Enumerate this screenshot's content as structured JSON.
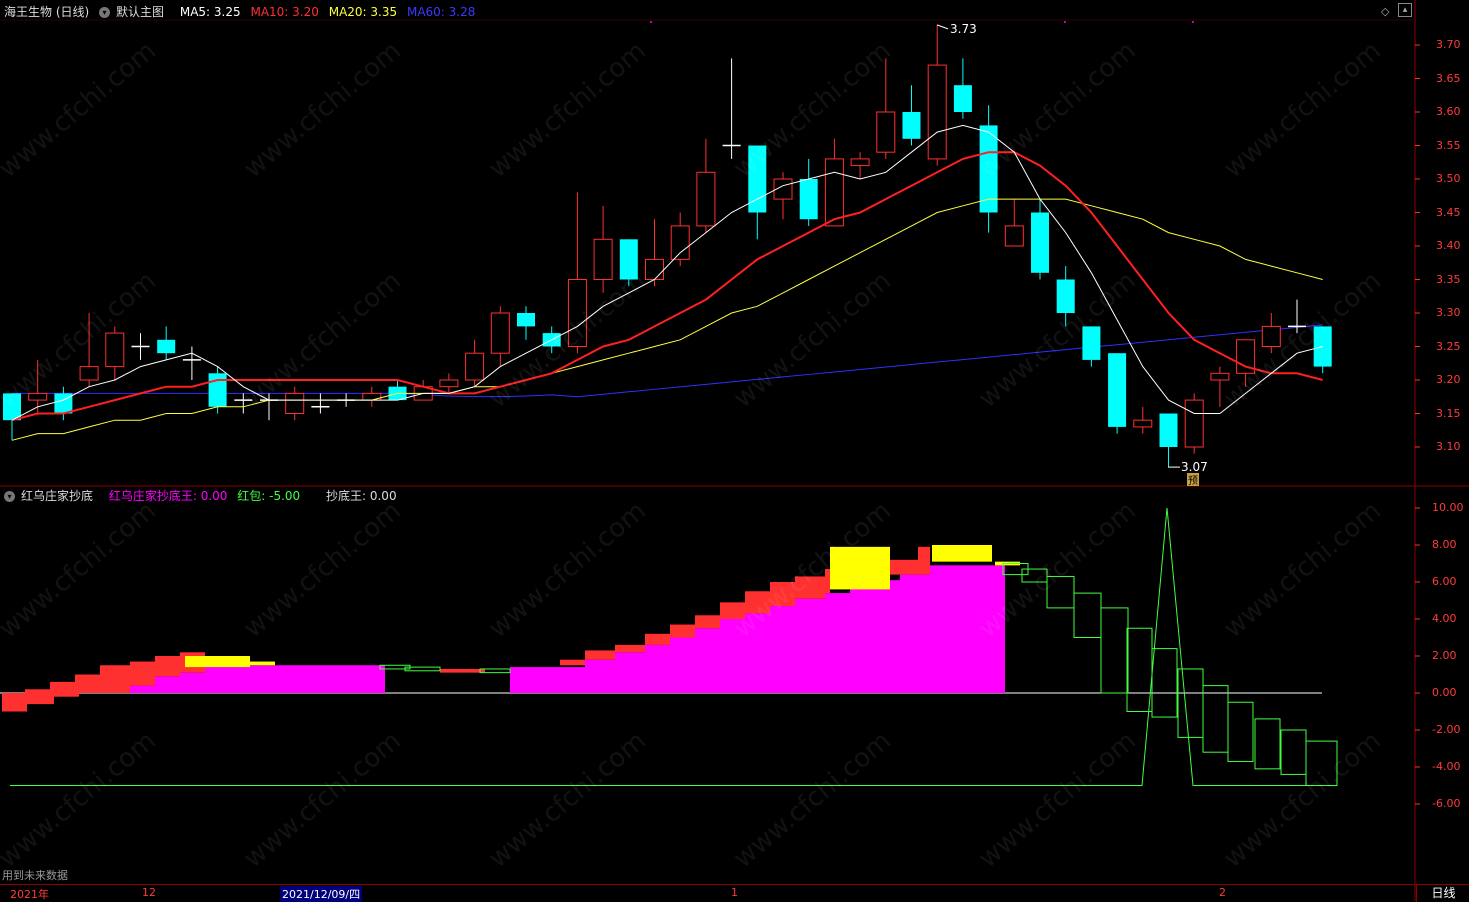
{
  "header_main": {
    "stock": "海王生物 (日线)",
    "indicator": "默认主图",
    "ma5": "MA5: 3.25",
    "ma10": "MA10: 3.20",
    "ma20": "MA20: 3.35",
    "ma60": "MA60: 3.28"
  },
  "header_sub": {
    "indicator": "红乌庄家抄底",
    "v1": "红乌庄家抄底王: 0.00",
    "v2": "红包: -5.00",
    "v3": "抄底王: 0.00"
  },
  "price_axis": [
    "3.70",
    "3.65",
    "3.60",
    "3.55",
    "3.50",
    "3.45",
    "3.40",
    "3.35",
    "3.30",
    "3.25",
    "3.20",
    "3.15",
    "3.10"
  ],
  "sub_axis": [
    "10.00",
    "8.00",
    "6.00",
    "4.00",
    "2.00",
    "0.00",
    "-2.00",
    "-4.00",
    "-6.00"
  ],
  "annotations": {
    "high": "3.73",
    "low": "3.07",
    "marker": "预"
  },
  "date_bar": {
    "year": "2021年",
    "m12": "12",
    "active": "2021/12/09/四",
    "m1": "1",
    "m2": "2"
  },
  "period": "日线",
  "future_note": "用到未来数据",
  "watermark": "www.cfchi.com",
  "colors": {
    "up": "#ff3030",
    "down": "#00ffff",
    "ma5": "#ffffff",
    "ma10": "#ff2020",
    "ma20": "#ffff40",
    "ma60": "#3030ff",
    "magenta": "#ff00ff",
    "yellow": "#ffff00",
    "green": "#40ff40"
  },
  "candles": [
    [
      3.18,
      3.14,
      3.11,
      3.18
    ],
    [
      3.17,
      3.18,
      3.15,
      3.23
    ],
    [
      3.18,
      3.15,
      3.14,
      3.19
    ],
    [
      3.2,
      3.22,
      3.19,
      3.3
    ],
    [
      3.22,
      3.27,
      3.2,
      3.28
    ],
    [
      3.25,
      3.25,
      3.23,
      3.27
    ],
    [
      3.26,
      3.24,
      3.23,
      3.28
    ],
    [
      3.23,
      3.23,
      3.2,
      3.25
    ],
    [
      3.21,
      3.16,
      3.15,
      3.22
    ],
    [
      3.17,
      3.17,
      3.15,
      3.18
    ],
    [
      3.17,
      3.17,
      3.14,
      3.18
    ],
    [
      3.15,
      3.18,
      3.14,
      3.19
    ],
    [
      3.16,
      3.16,
      3.15,
      3.18
    ],
    [
      3.17,
      3.17,
      3.16,
      3.18
    ],
    [
      3.17,
      3.18,
      3.16,
      3.19
    ],
    [
      3.19,
      3.17,
      3.17,
      3.2
    ],
    [
      3.17,
      3.19,
      3.17,
      3.2
    ],
    [
      3.19,
      3.2,
      3.18,
      3.21
    ],
    [
      3.2,
      3.24,
      3.19,
      3.26
    ],
    [
      3.24,
      3.3,
      3.22,
      3.31
    ],
    [
      3.3,
      3.28,
      3.26,
      3.31
    ],
    [
      3.27,
      3.25,
      3.24,
      3.28
    ],
    [
      3.25,
      3.35,
      3.24,
      3.48
    ],
    [
      3.35,
      3.41,
      3.33,
      3.46
    ],
    [
      3.41,
      3.35,
      3.34,
      3.41
    ],
    [
      3.35,
      3.38,
      3.34,
      3.44
    ],
    [
      3.38,
      3.43,
      3.37,
      3.45
    ],
    [
      3.43,
      3.51,
      3.42,
      3.56
    ],
    [
      3.55,
      3.55,
      3.53,
      3.68
    ],
    [
      3.55,
      3.45,
      3.41,
      3.55
    ],
    [
      3.47,
      3.5,
      3.44,
      3.51
    ],
    [
      3.5,
      3.44,
      3.43,
      3.53
    ],
    [
      3.43,
      3.53,
      3.43,
      3.56
    ],
    [
      3.52,
      3.53,
      3.5,
      3.54
    ],
    [
      3.54,
      3.6,
      3.53,
      3.68
    ],
    [
      3.6,
      3.56,
      3.55,
      3.64
    ],
    [
      3.53,
      3.67,
      3.52,
      3.73
    ],
    [
      3.64,
      3.6,
      3.59,
      3.68
    ],
    [
      3.58,
      3.45,
      3.42,
      3.61
    ],
    [
      3.4,
      3.43,
      3.4,
      3.47
    ],
    [
      3.45,
      3.36,
      3.35,
      3.47
    ],
    [
      3.35,
      3.3,
      3.28,
      3.37
    ],
    [
      3.28,
      3.23,
      3.22,
      3.28
    ],
    [
      3.24,
      3.13,
      3.12,
      3.24
    ],
    [
      3.13,
      3.14,
      3.12,
      3.16
    ],
    [
      3.15,
      3.1,
      3.07,
      3.15
    ],
    [
      3.1,
      3.17,
      3.09,
      3.18
    ],
    [
      3.2,
      3.21,
      3.16,
      3.22
    ],
    [
      3.21,
      3.26,
      3.19,
      3.26
    ],
    [
      3.25,
      3.28,
      3.24,
      3.3
    ],
    [
      3.28,
      3.28,
      3.27,
      3.32
    ],
    [
      3.28,
      3.22,
      3.21,
      3.28
    ]
  ],
  "ma5_line": [
    3.14,
    3.16,
    3.17,
    3.19,
    3.2,
    3.22,
    3.23,
    3.24,
    3.22,
    3.19,
    3.17,
    3.17,
    3.17,
    3.17,
    3.17,
    3.17,
    3.18,
    3.18,
    3.19,
    3.22,
    3.24,
    3.26,
    3.28,
    3.31,
    3.33,
    3.35,
    3.39,
    3.42,
    3.45,
    3.47,
    3.49,
    3.5,
    3.51,
    3.5,
    3.51,
    3.54,
    3.57,
    3.58,
    3.57,
    3.54,
    3.47,
    3.42,
    3.36,
    3.29,
    3.22,
    3.17,
    3.15,
    3.15,
    3.18,
    3.21,
    3.24,
    3.25
  ],
  "ma10_line": [
    3.14,
    3.15,
    3.15,
    3.16,
    3.17,
    3.18,
    3.19,
    3.19,
    3.2,
    3.2,
    3.2,
    3.2,
    3.2,
    3.2,
    3.2,
    3.2,
    3.19,
    3.18,
    3.18,
    3.19,
    3.2,
    3.21,
    3.23,
    3.25,
    3.26,
    3.28,
    3.3,
    3.32,
    3.35,
    3.38,
    3.4,
    3.42,
    3.44,
    3.45,
    3.47,
    3.49,
    3.51,
    3.53,
    3.54,
    3.54,
    3.52,
    3.49,
    3.45,
    3.4,
    3.35,
    3.3,
    3.26,
    3.24,
    3.22,
    3.21,
    3.21,
    3.2
  ],
  "ma20_line": [
    3.11,
    3.12,
    3.12,
    3.13,
    3.14,
    3.14,
    3.15,
    3.15,
    3.16,
    3.16,
    3.17,
    3.17,
    3.17,
    3.17,
    3.17,
    3.18,
    3.18,
    3.18,
    3.19,
    3.19,
    3.2,
    3.21,
    3.22,
    3.23,
    3.24,
    3.25,
    3.26,
    3.28,
    3.3,
    3.31,
    3.33,
    3.35,
    3.37,
    3.39,
    3.41,
    3.43,
    3.45,
    3.46,
    3.47,
    3.47,
    3.47,
    3.47,
    3.46,
    3.45,
    3.44,
    3.42,
    3.41,
    3.4,
    3.38,
    3.37,
    3.36,
    3.35
  ]
}
